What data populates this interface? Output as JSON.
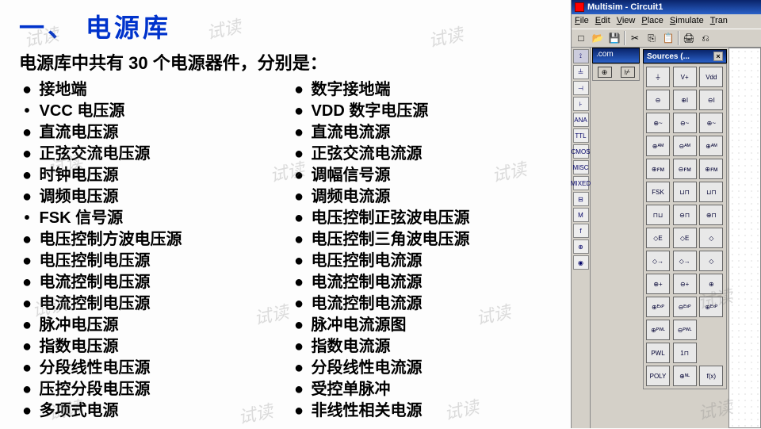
{
  "title": "一、 电源库",
  "subtitle": "电源库中共有 30 个电源器件，分别是：",
  "watermark": "试读",
  "col1": [
    {
      "b": "●",
      "t": "  接地端"
    },
    {
      "b": "•",
      "t": " VCC 电压源"
    },
    {
      "b": "●",
      "t": "  直流电压源"
    },
    {
      "b": "●",
      "t": "  正弦交流电压源"
    },
    {
      "b": "●",
      "t": "  时钟电压源"
    },
    {
      "b": "●",
      "t": "  调频电压源"
    },
    {
      "b": "•",
      "t": " FSK 信号源"
    },
    {
      "b": "●",
      "t": "  电压控制方波电压源"
    },
    {
      "b": "●",
      "t": "  电压控制电压源"
    },
    {
      "b": "●",
      "t": "  电流控制电压源"
    },
    {
      "b": "●",
      "t": "  电流控制电压源"
    },
    {
      "b": "●",
      "t": "  脉冲电压源"
    },
    {
      "b": "●",
      "t": "  指数电压源"
    },
    {
      "b": "●",
      "t": "  分段线性电压源"
    },
    {
      "b": "●",
      "t": "  压控分段电压源"
    },
    {
      "b": "●",
      "t": "  多项式电源"
    }
  ],
  "col2": [
    {
      "b": "●",
      "t": "  数字接地端"
    },
    {
      "b": "●",
      "t": " VDD 数字电压源"
    },
    {
      "b": "●",
      "t": "  直流电流源"
    },
    {
      "b": "●",
      "t": " 正弦交流电流源"
    },
    {
      "b": "●",
      "t": "  调幅信号源"
    },
    {
      "b": "●",
      "t": "  调频电流源"
    },
    {
      "b": "●",
      "t": " 电压控制正弦波电压源"
    },
    {
      "b": "●",
      "t": " 电压控制三角波电压源"
    },
    {
      "b": "●",
      "t": " 电压控制电流源"
    },
    {
      "b": "●",
      "t": " 电流控制电流源"
    },
    {
      "b": "●",
      "t": " 电流控制电流源"
    },
    {
      "b": "●",
      "t": "  脉冲电流源图"
    },
    {
      "b": "●",
      "t": "  指数电流源"
    },
    {
      "b": "●",
      "t": " 分段线性电流源"
    },
    {
      "b": "●",
      "t": " 受控单脉冲"
    },
    {
      "b": "●",
      "t": "  非线性相关电源"
    }
  ],
  "app": {
    "title": "Multisim - Circuit1",
    "menus": [
      "File",
      "Edit",
      "View",
      "Place",
      "Simulate",
      "Tran"
    ],
    "toolbar": [
      "□",
      "📂",
      "💾",
      "",
      "✂",
      "⎘",
      "📋",
      "",
      "🖨",
      "⎌"
    ],
    "leftdock": [
      "⟟",
      "╧",
      "⊣",
      "⊦",
      "ANA",
      "TTL",
      "CMOS",
      "MISC",
      "MIXED",
      "⊟",
      "M",
      "f",
      "⊕",
      "◉"
    ],
    "comp_label": ".com",
    "palette_title": "Sources (...",
    "palette": [
      "⏚",
      "V+",
      "Vdd",
      "⊖",
      "⊕I",
      "⊖I",
      "⊕~",
      "⊖~",
      "⊕~",
      "⊕ᴬᴹ",
      "⊖ᴬᴹ",
      "⊕ᴬᴹ",
      "⊕ꜰᴍ",
      "⊖ꜰᴍ",
      "⊕ꜰᴍ",
      "FSK",
      "⊔⊓",
      "⊔⊓",
      "⊓⊔",
      "⊖⊓",
      "⊕⊓",
      "◇E",
      "◇E",
      "◇",
      "◇→",
      "◇→",
      "◇",
      "⊕+",
      "⊖+",
      "⊕",
      "⊕ᴱˣᴾ",
      "⊖ᴱˣᴾ",
      "⊕ᴱˣᴾ",
      "⊕ᴾᵂᴸ",
      "⊖ᴾᵂᴸ",
      "",
      "PWL",
      "1⊓",
      "",
      "POLY",
      "⊕ᴺᴸ",
      "f(x)"
    ]
  }
}
